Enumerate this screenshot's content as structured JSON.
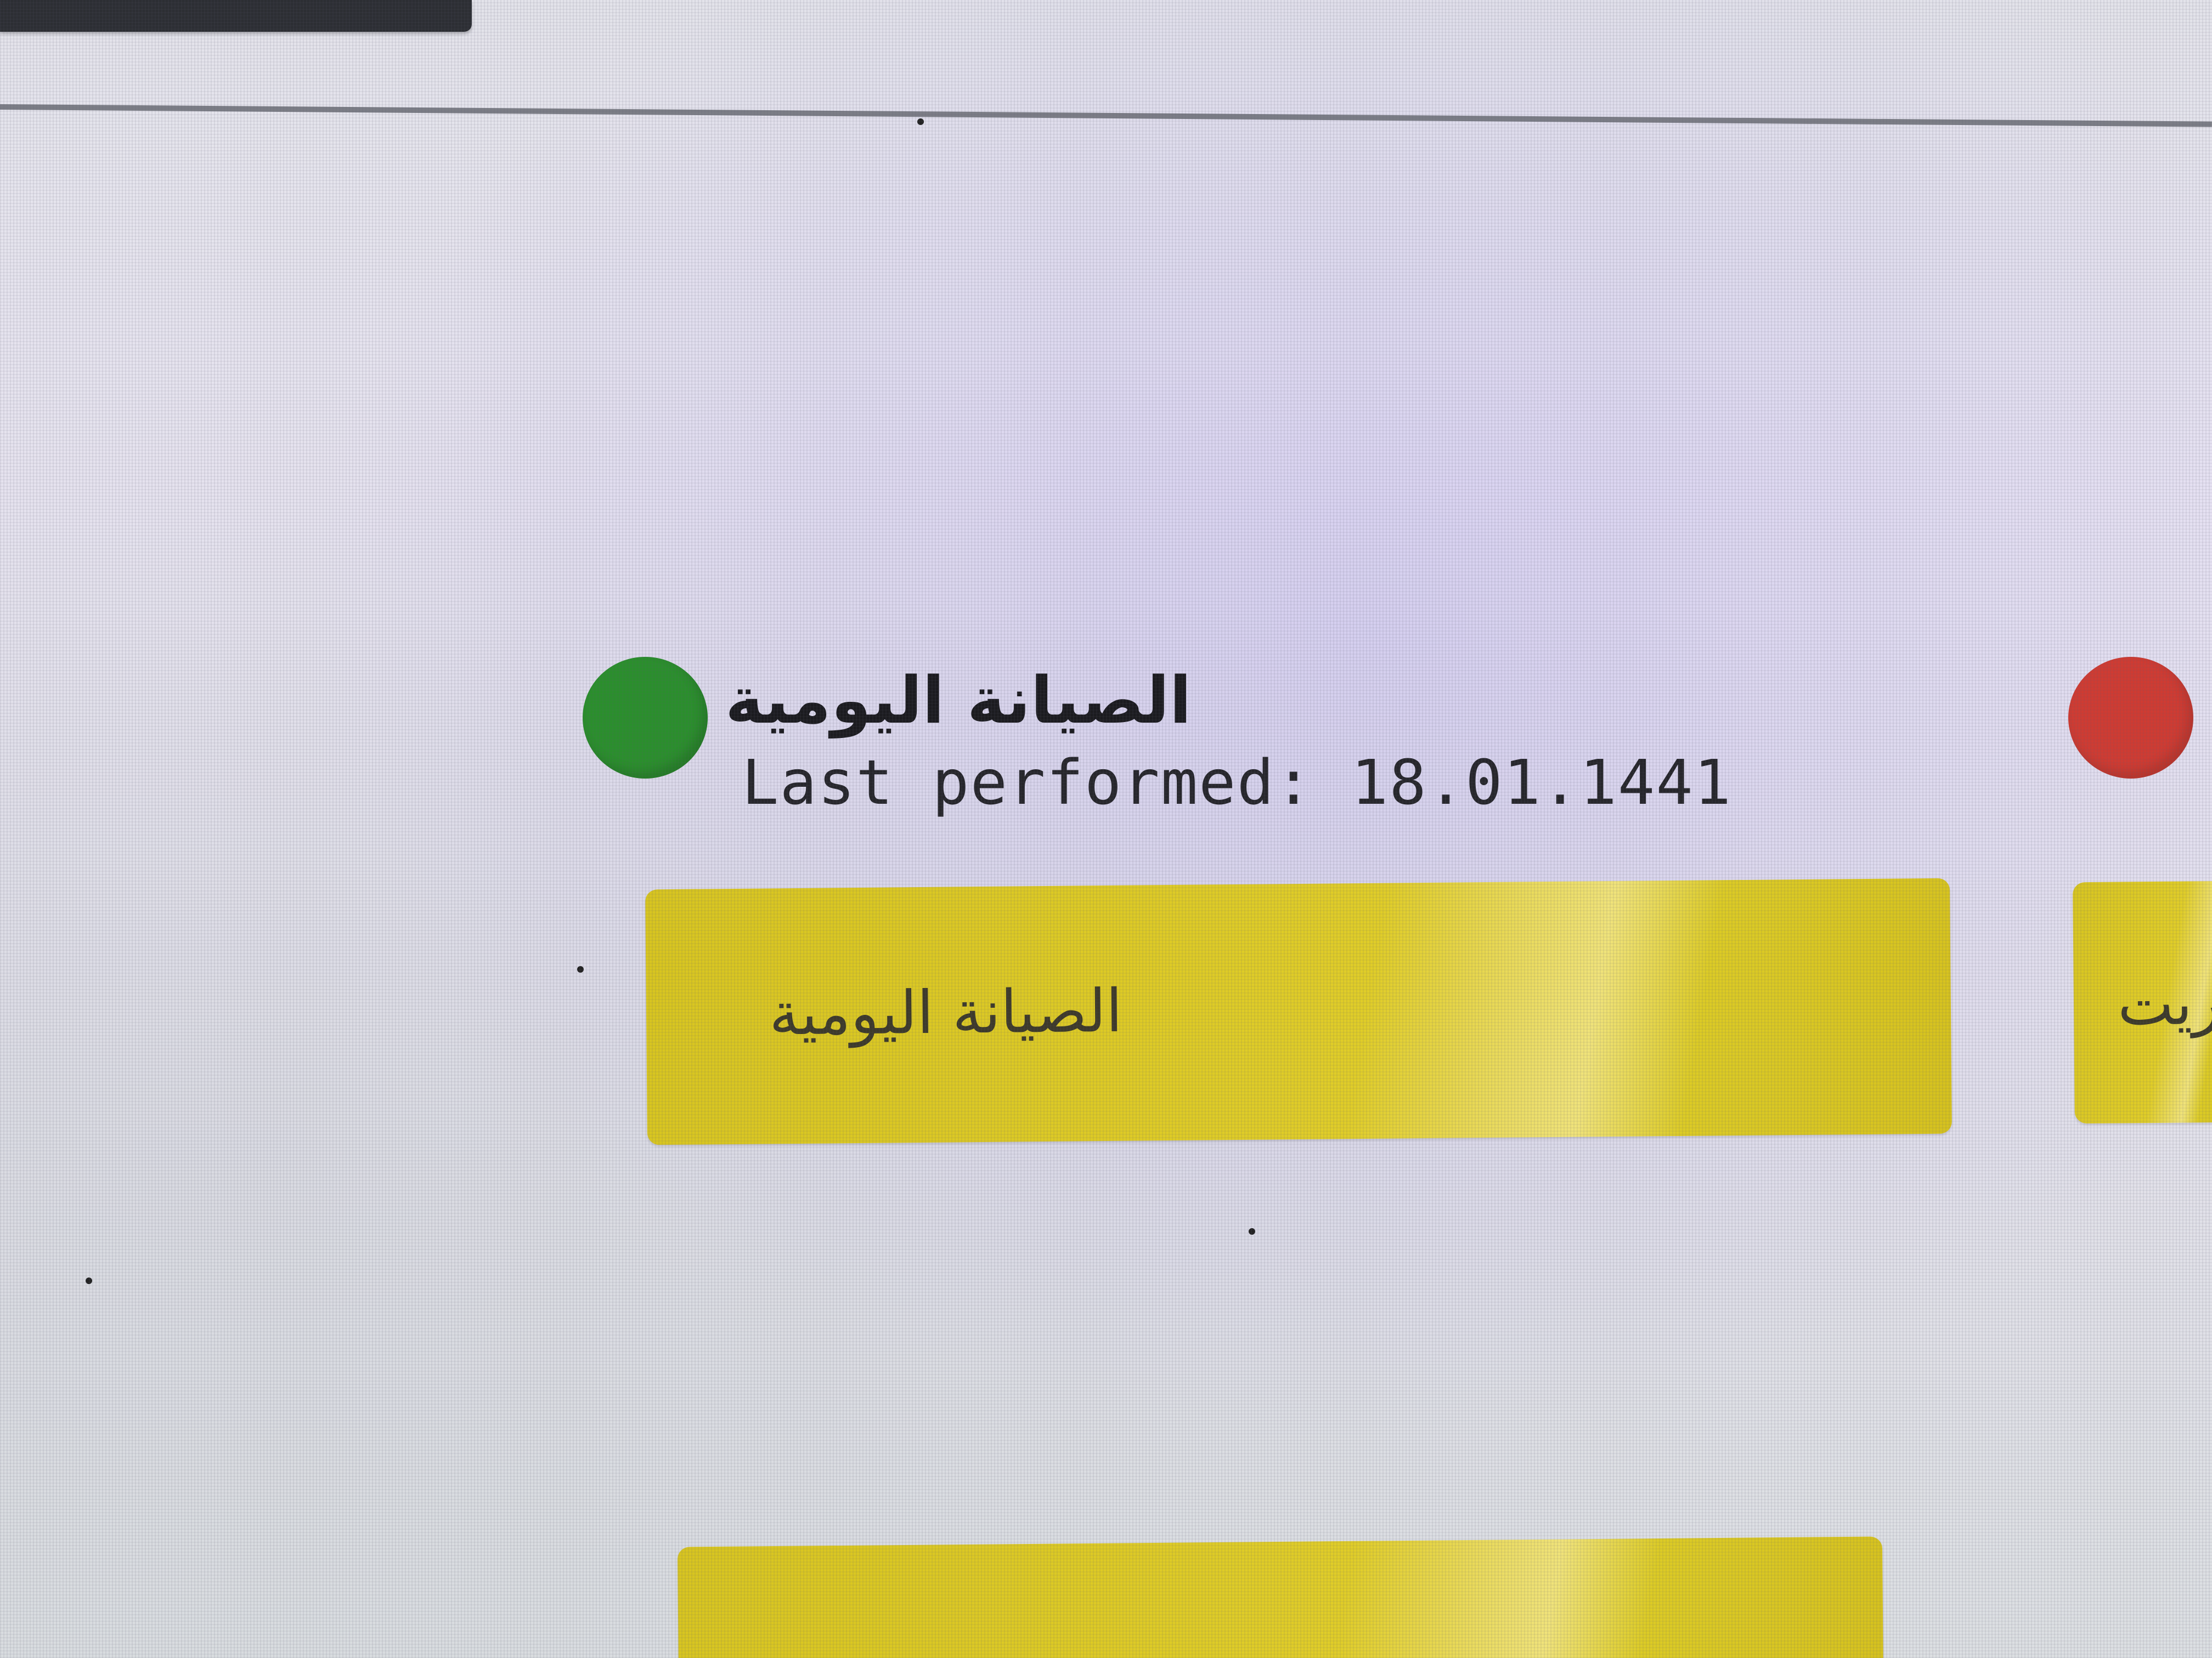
{
  "maintenance_cards": [
    {
      "title": "الصيانة اليومية",
      "last_performed_label": "Last performed:",
      "last_performed_date": "18.01.1441",
      "status_color": "#2a8f2c",
      "status": "green",
      "button_label": "الصيانة اليومية"
    },
    {
      "status_color": "#cf3b32",
      "status": "red",
      "button_label": "ريت"
    }
  ],
  "colors": {
    "button_yellow": "#dcc823",
    "background": "#e6e3ef",
    "top_bar": "#2c2e33"
  }
}
